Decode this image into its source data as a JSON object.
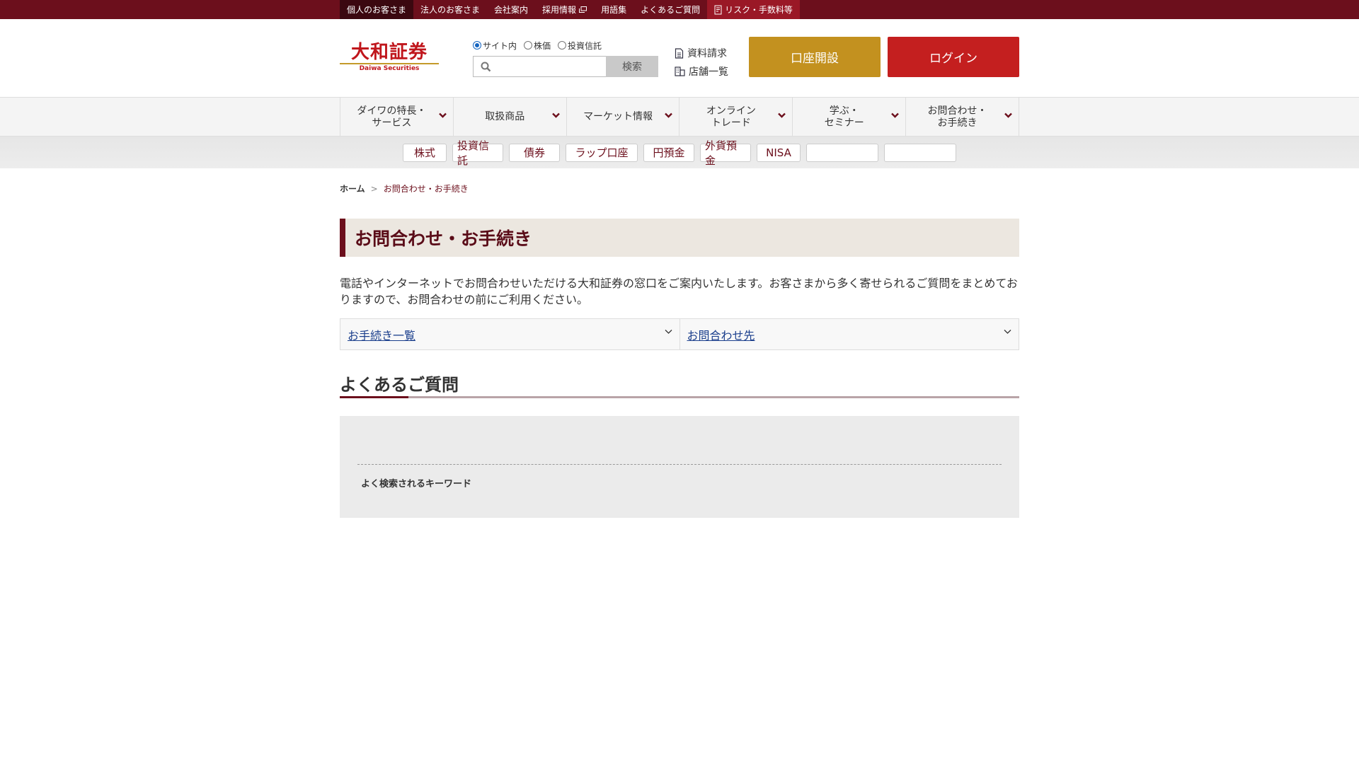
{
  "topbar": {
    "items": [
      "個人のお客さま",
      "法人のお客さま",
      "会社案内",
      "採用情報",
      "用語集",
      "よくあるご質問",
      "リスク・手数料等"
    ]
  },
  "header": {
    "logo_jp": "大和証券",
    "logo_en": "Daiwa Securities",
    "search": {
      "options": [
        "サイト内",
        "株価",
        "投資信託"
      ],
      "selected": "サイト内",
      "input_value": "",
      "button": "検索"
    },
    "links": [
      "資料請求",
      "店舗一覧"
    ],
    "open_account": "口座開設",
    "login": "ログイン"
  },
  "gnav": {
    "items": [
      {
        "l1": "ダイワの特長・",
        "l2": "サービス"
      },
      {
        "l1": "取扱商品",
        "l2": ""
      },
      {
        "l1": "マーケット情報",
        "l2": ""
      },
      {
        "l1": "オンライン",
        "l2": "トレード"
      },
      {
        "l1": "学ぶ・",
        "l2": "セミナー"
      },
      {
        "l1": "お問合わせ・",
        "l2": "お手続き"
      }
    ]
  },
  "ptabs": [
    "株式",
    "投資信託",
    "債券",
    "ラップ口座",
    "円預金",
    "外貨預金",
    "NISA",
    "",
    ""
  ],
  "breadcrumb": {
    "home": "ホーム",
    "sep": ">",
    "current": "お問合わせ・お手続き"
  },
  "page": {
    "title": "お問合わせ・お手続き",
    "lead": "電話やインターネットでお問合わせいただける大和証券の窓口をご案内いたします。お客さまから多く寄せられるご質問をまとめておりますので、お問合わせの前にご利用ください。",
    "accordion": [
      "お手続き一覧",
      "お問合わせ先"
    ],
    "faq_heading": "よくあるご質問",
    "keyword_label": "よく検索されるキーワード"
  },
  "colors": {
    "brand": "#6c0f1c",
    "gold": "#c3911f",
    "red": "#c41f1f"
  }
}
